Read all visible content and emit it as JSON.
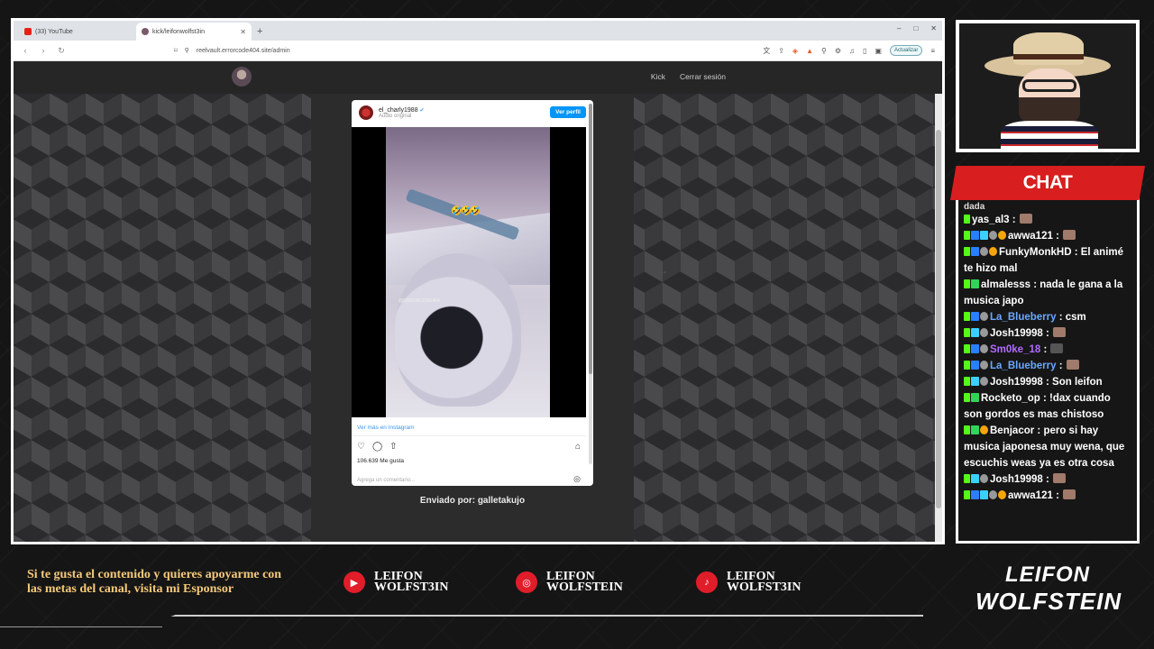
{
  "browser": {
    "tabs": [
      {
        "label": "(33) YouTube",
        "icon": "youtube-icon",
        "active": false
      },
      {
        "label": "kick/leifonwolfst3in",
        "icon": "kick-icon",
        "active": true
      }
    ],
    "new_tab": "+",
    "address": "reelvault.errorcode404.site/admin",
    "update_button": "Actualizar",
    "window_controls": [
      "–",
      "□",
      "✕"
    ]
  },
  "site": {
    "nav_links": [
      "Kick",
      "Cerrar sesión"
    ],
    "left_arrow": "←",
    "right_arrow": "→",
    "sent_by": "Enviado por: galletakujo"
  },
  "instagram": {
    "username": "el_charly1988",
    "verified": "✔",
    "subtitle": "Audio original",
    "follow_button": "Ver perfil",
    "emoji": "🤣🤣🤣",
    "watermark": "@ERRORCODE404",
    "view_more": "Ver más en Instagram",
    "likes": "106.639 Me gusta",
    "comment_placeholder": "Agrega un comentario..."
  },
  "chat": {
    "title": "CHAT",
    "cut_line": "dada",
    "messages": [
      {
        "user": "yas_al3",
        "color": "#ffffff",
        "badges": [
          "k"
        ],
        "text": "",
        "emote": "emote"
      },
      {
        "user": "awwa121",
        "color": "#ffffff",
        "badges": [
          "k",
          "blue",
          "cyan",
          "gray",
          "orange"
        ],
        "text": "",
        "emote": "emote"
      },
      {
        "user": "FunkyMonkHD",
        "color": "#ffffff",
        "badges": [
          "k",
          "blue",
          "gray",
          "orange"
        ],
        "text": " El animé te hizo mal"
      },
      {
        "user": "almalesss",
        "color": "#ffffff",
        "badges": [
          "k",
          "green"
        ],
        "text": " nada le gana a la musica japo"
      },
      {
        "user": "La_Blueberry",
        "color": "#6aa8ff",
        "badges": [
          "k",
          "blue",
          "gray"
        ],
        "text": " csm"
      },
      {
        "user": "Josh19998",
        "color": "#ffffff",
        "badges": [
          "k",
          "cyan",
          "gray"
        ],
        "text": "",
        "emote": "emote"
      },
      {
        "user": "Sm0ke_18",
        "color": "#b36bff",
        "badges": [
          "k",
          "blue",
          "gray"
        ],
        "text": "",
        "emote": "emote-dark"
      },
      {
        "user": "La_Blueberry",
        "color": "#6aa8ff",
        "badges": [
          "k",
          "blue",
          "gray"
        ],
        "text": "",
        "emote": "emote"
      },
      {
        "user": "Josh19998",
        "color": "#ffffff",
        "badges": [
          "k",
          "cyan",
          "gray"
        ],
        "text": " Son leifon"
      },
      {
        "user": "Rocketo_op",
        "color": "#ffffff",
        "badges": [
          "k",
          "green"
        ],
        "text": " !dax cuando son gordos es mas chistoso"
      },
      {
        "user": "Benjacor",
        "color": "#ffffff",
        "badges": [
          "k",
          "green",
          "orange"
        ],
        "text": " pero si hay musica japonesa muy wena, que escuchis weas ya es otra cosa"
      },
      {
        "user": "Josh19998",
        "color": "#ffffff",
        "badges": [
          "k",
          "cyan",
          "gray"
        ],
        "text": "",
        "emote": "emote"
      },
      {
        "user": "awwa121",
        "color": "#ffffff",
        "badges": [
          "k",
          "blue",
          "cyan",
          "gray",
          "orange"
        ],
        "text": "",
        "emote": "emote"
      }
    ]
  },
  "footer": {
    "sponsor_text": "Si te gusta el contenido y quieres apoyarme con las metas del canal, visita mi Esponsor",
    "socials": [
      {
        "icon": "youtube-icon",
        "glyph": "▶",
        "line1": "LEIFON",
        "line2": "WOLFST3IN"
      },
      {
        "icon": "instagram-icon",
        "glyph": "◎",
        "line1": "LEIFON",
        "line2": "WOLFSTEIN"
      },
      {
        "icon": "tiktok-icon",
        "glyph": "♪",
        "line1": "LEIFON",
        "line2": "WOLFST3IN"
      }
    ],
    "logo_line1": "LEIFON",
    "logo_line2": "WOLFSTEIN"
  },
  "colors": {
    "accent_red": "#d81e1e",
    "kick_green": "#53fc18",
    "ig_blue": "#0095f6",
    "sponsor_gold": "#f5c97a"
  }
}
